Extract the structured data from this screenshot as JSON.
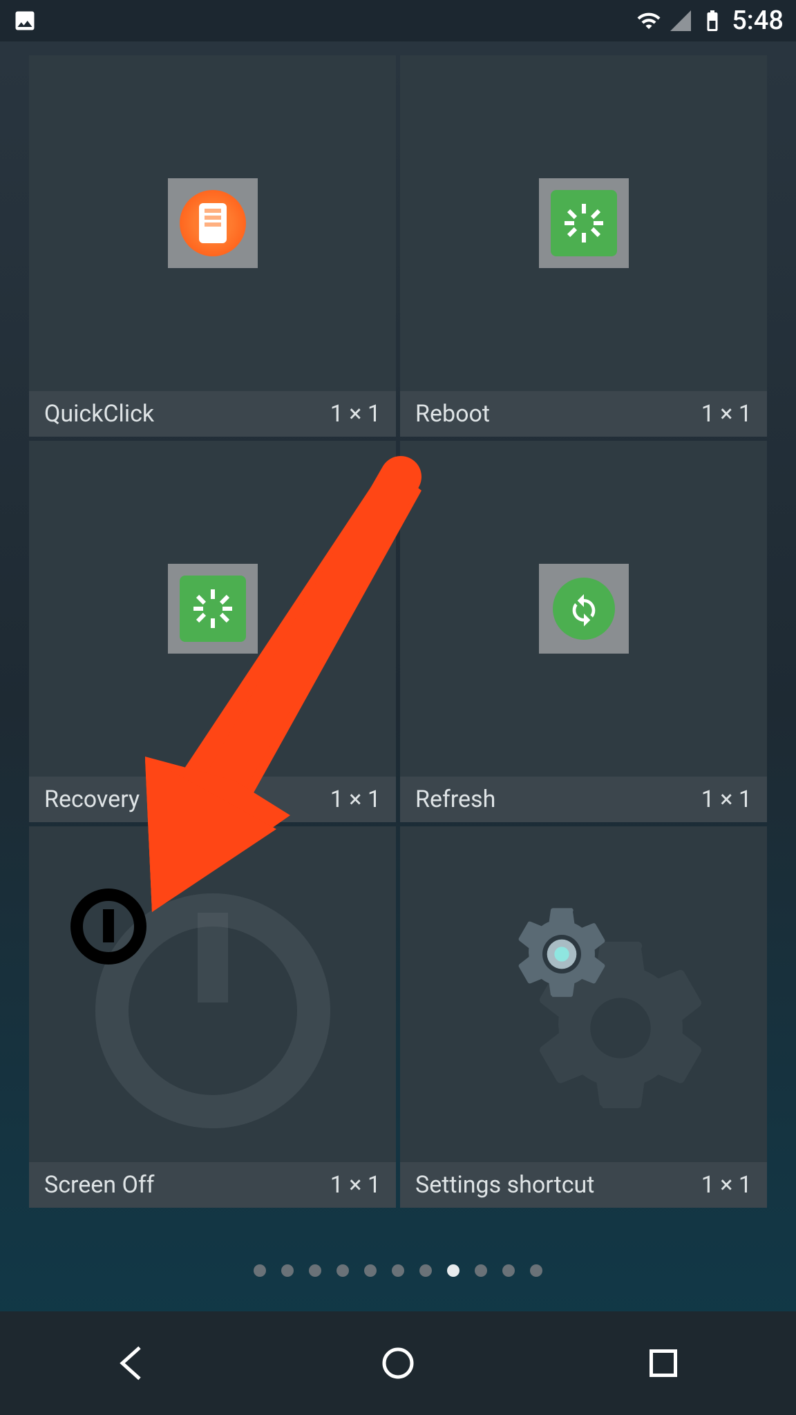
{
  "status_bar": {
    "time": "5:48"
  },
  "widgets": [
    {
      "name": "QuickClick",
      "size": "1 × 1"
    },
    {
      "name": "Reboot",
      "size": "1 × 1"
    },
    {
      "name": "Recovery",
      "size": "1 × 1"
    },
    {
      "name": "Refresh",
      "size": "1 × 1"
    },
    {
      "name": "Screen Off",
      "size": "1 × 1"
    },
    {
      "name": "Settings shortcut",
      "size": "1 × 1"
    }
  ],
  "page_indicator": {
    "count": 11,
    "active": 7
  }
}
